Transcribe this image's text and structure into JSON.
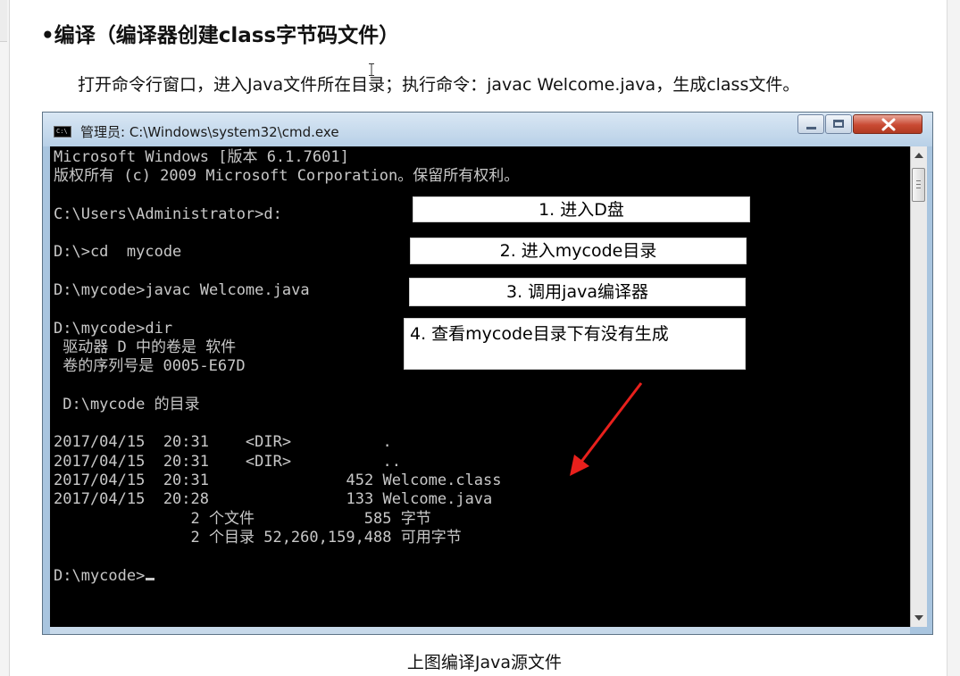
{
  "document": {
    "heading": "•编译（编译器创建class字节码文件）",
    "paragraph": "打开命令行窗口，进入Java文件所在目录；执行命令：javac  Welcome.java，生成class文件。",
    "caption": "上图编译Java源文件"
  },
  "cmd_window": {
    "title": "管理员: C:\\Windows\\system32\\cmd.exe",
    "icon_text": "C:\\",
    "lines": [
      "Microsoft Windows [版本 6.1.7601]",
      "版权所有 (c) 2009 Microsoft Corporation。保留所有权利。",
      "",
      "C:\\Users\\Administrator>d:",
      "",
      "D:\\>cd  mycode",
      "",
      "D:\\mycode>javac Welcome.java",
      "",
      "D:\\mycode>dir",
      " 驱动器 D 中的卷是 软件",
      " 卷的序列号是 0005-E67D",
      "",
      " D:\\mycode 的目录",
      "",
      "2017/04/15  20:31    <DIR>          .",
      "2017/04/15  20:31    <DIR>          ..",
      "2017/04/15  20:31               452 Welcome.class",
      "2017/04/15  20:28               133 Welcome.java",
      "               2 个文件            585 字节",
      "               2 个目录 52,260,159,488 可用字节",
      "",
      "D:\\mycode>"
    ]
  },
  "annotations": {
    "step1": "1. 进入D盘",
    "step2": "2. 进入mycode目录",
    "step3": "3. 调用java编译器",
    "step4": "4. 查看mycode目录下有没有生成"
  },
  "colors": {
    "arrow": "#e8201c",
    "console_bg": "#000000",
    "console_text": "#c8c8c8",
    "titlebar": "#b8d0e7"
  }
}
